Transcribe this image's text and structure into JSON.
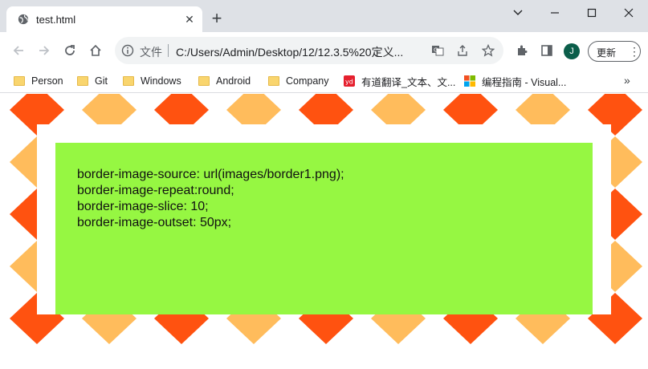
{
  "browser": {
    "tab": {
      "title": "test.html"
    },
    "address": {
      "scheme_label": "文件",
      "url": "C:/Users/Admin/Desktop/12/12.3.5%20定义..."
    },
    "profile_initial": "J",
    "update_label": "更新"
  },
  "bookmarks": [
    {
      "label": "Person",
      "icon": "folder-icon"
    },
    {
      "label": "Git",
      "icon": "folder-icon"
    },
    {
      "label": "Windows",
      "icon": "folder-icon"
    },
    {
      "label": "Android",
      "icon": "folder-icon"
    },
    {
      "label": "Company",
      "icon": "folder-icon"
    },
    {
      "label": "有道翻译_文本、文...",
      "icon": "youdao-icon"
    },
    {
      "label": "编程指南 - Visual...",
      "icon": "microsoft-icon"
    }
  ],
  "page": {
    "lines": [
      "border-image-source: url(images/border1.png);",
      "border-image-repeat:round;",
      "border-image-slice: 10;",
      "border-image-outset: 50px;"
    ]
  },
  "colors": {
    "box_background": "#96f742",
    "diamond_dark": "#ff5210",
    "diamond_light": "#ffbc5c",
    "tab_strip": "#dee1e6"
  }
}
